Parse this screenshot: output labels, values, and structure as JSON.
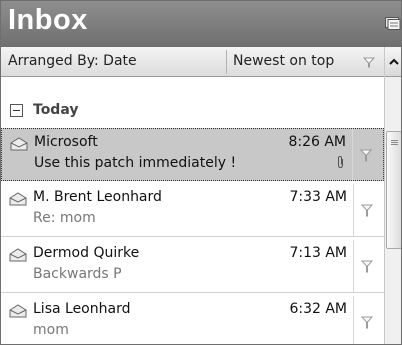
{
  "header": {
    "title": "Inbox",
    "icon": "folder-menu-icon"
  },
  "arrange": {
    "by_label": "Arranged By: Date",
    "order_label": "Newest on top"
  },
  "groups": [
    {
      "label": "Today",
      "expanded": true
    }
  ],
  "messages": [
    {
      "sender": "Microsoft",
      "subject": "Use this patch immediately !",
      "time": "8:26 AM",
      "selected": true,
      "attachment": true,
      "read": true
    },
    {
      "sender": "M. Brent Leonhard",
      "subject": "Re: mom",
      "time": "7:33 AM",
      "selected": false,
      "attachment": false,
      "read": true
    },
    {
      "sender": "Dermod Quirke",
      "subject": "Backwards P",
      "time": "7:13 AM",
      "selected": false,
      "attachment": false,
      "read": true
    },
    {
      "sender": "Lisa Leonhard",
      "subject": "mom",
      "time": "6:32 AM",
      "selected": false,
      "attachment": false,
      "read": true
    }
  ],
  "colors": {
    "header_bg": "#7f7f7f",
    "selected_bg": "#c8c8c8",
    "subject_text": "#777777"
  }
}
